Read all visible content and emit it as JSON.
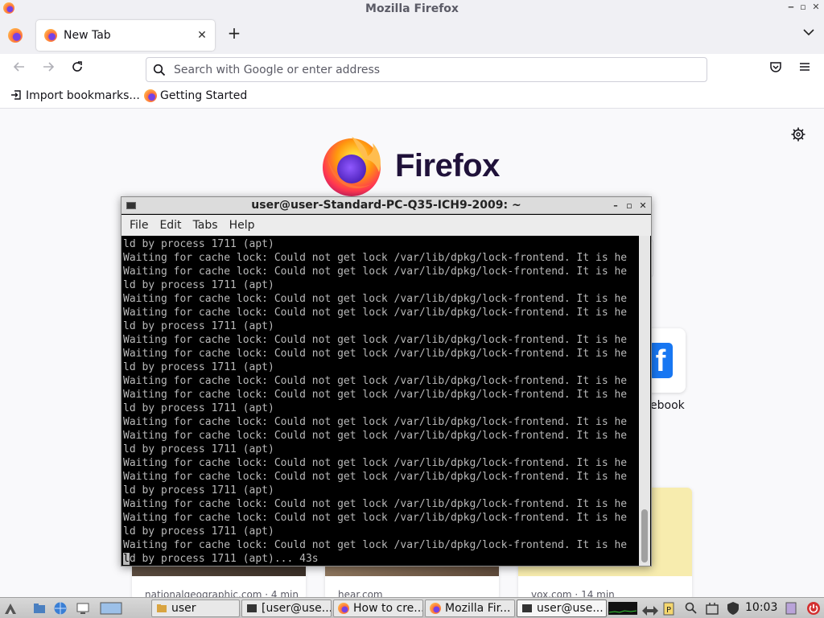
{
  "window": {
    "title": "Mozilla Firefox",
    "controls": [
      "minimize",
      "maximize",
      "close"
    ]
  },
  "tabs": [
    {
      "label": "New Tab",
      "icon": "firefox-icon",
      "active": true
    }
  ],
  "navbar": {
    "back_icon": "arrow-left-icon",
    "forward_icon": "arrow-right-icon",
    "reload_icon": "reload-icon",
    "search_placeholder": "Search with Google or enter address",
    "pocket_icon": "pocket-icon",
    "menu_icon": "hamburger-icon"
  },
  "bookmarks": [
    {
      "label": "Import bookmarks...",
      "icon": "import-icon"
    },
    {
      "label": "Getting Started",
      "icon": "firefox-icon"
    }
  ],
  "newtab": {
    "brand": "Firefox",
    "shortcut_label": "ebook",
    "stories": [
      {
        "source": "nationalgeographic.com · 4 min"
      },
      {
        "source": "hear.com"
      },
      {
        "source": "vox.com · 14 min"
      }
    ]
  },
  "terminal": {
    "title": "user@user-Standard-PC-Q35-ICH9-2009: ~",
    "menu": [
      "File",
      "Edit",
      "Tabs",
      "Help"
    ],
    "lines": [
      "ld by process 1711 (apt)",
      "Waiting for cache lock: Could not get lock /var/lib/dpkg/lock-frontend. It is he",
      "Waiting for cache lock: Could not get lock /var/lib/dpkg/lock-frontend. It is he",
      "ld by process 1711 (apt)",
      "Waiting for cache lock: Could not get lock /var/lib/dpkg/lock-frontend. It is he",
      "Waiting for cache lock: Could not get lock /var/lib/dpkg/lock-frontend. It is he",
      "ld by process 1711 (apt)",
      "Waiting for cache lock: Could not get lock /var/lib/dpkg/lock-frontend. It is he",
      "Waiting for cache lock: Could not get lock /var/lib/dpkg/lock-frontend. It is he",
      "ld by process 1711 (apt)",
      "Waiting for cache lock: Could not get lock /var/lib/dpkg/lock-frontend. It is he",
      "Waiting for cache lock: Could not get lock /var/lib/dpkg/lock-frontend. It is he",
      "ld by process 1711 (apt)",
      "Waiting for cache lock: Could not get lock /var/lib/dpkg/lock-frontend. It is he",
      "Waiting for cache lock: Could not get lock /var/lib/dpkg/lock-frontend. It is he",
      "ld by process 1711 (apt)",
      "Waiting for cache lock: Could not get lock /var/lib/dpkg/lock-frontend. It is he",
      "Waiting for cache lock: Could not get lock /var/lib/dpkg/lock-frontend. It is he",
      "ld by process 1711 (apt)",
      "Waiting for cache lock: Could not get lock /var/lib/dpkg/lock-frontend. It is he",
      "Waiting for cache lock: Could not get lock /var/lib/dpkg/lock-frontend. It is he",
      "ld by process 1711 (apt)",
      "Waiting for cache lock: Could not get lock /var/lib/dpkg/lock-frontend. It is he",
      "ld by process 1711 (apt)... 43s"
    ]
  },
  "taskbar": {
    "tasks": [
      {
        "label": "user",
        "icon": "folder-icon"
      },
      {
        "label": "[user@use...",
        "icon": "terminal-icon"
      },
      {
        "label": "How to cre...",
        "icon": "firefox-icon"
      },
      {
        "label": "Mozilla Fir...",
        "icon": "firefox-icon"
      },
      {
        "label": "user@use...",
        "icon": "terminal-icon"
      }
    ],
    "clock": "10:03"
  },
  "colors": {
    "accent": "#0060df",
    "terminal_bg": "#000000",
    "terminal_fg": "#b9b9b9",
    "firefox_orange": "#ff7139",
    "firefox_purple": "#7542e5"
  }
}
